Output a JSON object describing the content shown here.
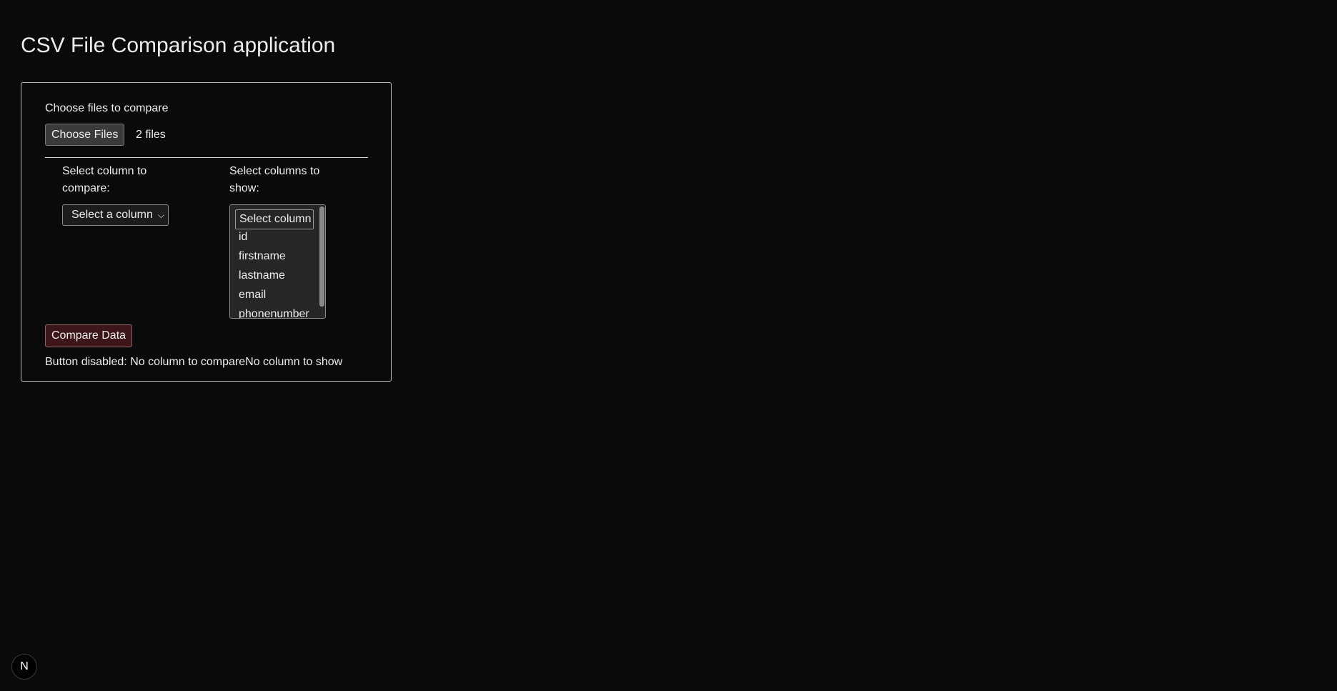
{
  "page": {
    "title": "CSV File Comparison application"
  },
  "files": {
    "label": "Choose files to compare",
    "button_label": "Choose Files",
    "selected_text": "2 files"
  },
  "compare_column": {
    "label": "Select column to compare:",
    "selected": "Select a column"
  },
  "show_columns": {
    "label": "Select columns to show:",
    "options": [
      "Select column",
      "id",
      "firstname",
      "lastname",
      "email",
      "phonenumber"
    ]
  },
  "actions": {
    "compare_label": "Compare Data",
    "status": "Button disabled: No column to compareNo column to show"
  },
  "badge": {
    "letter": "N"
  }
}
